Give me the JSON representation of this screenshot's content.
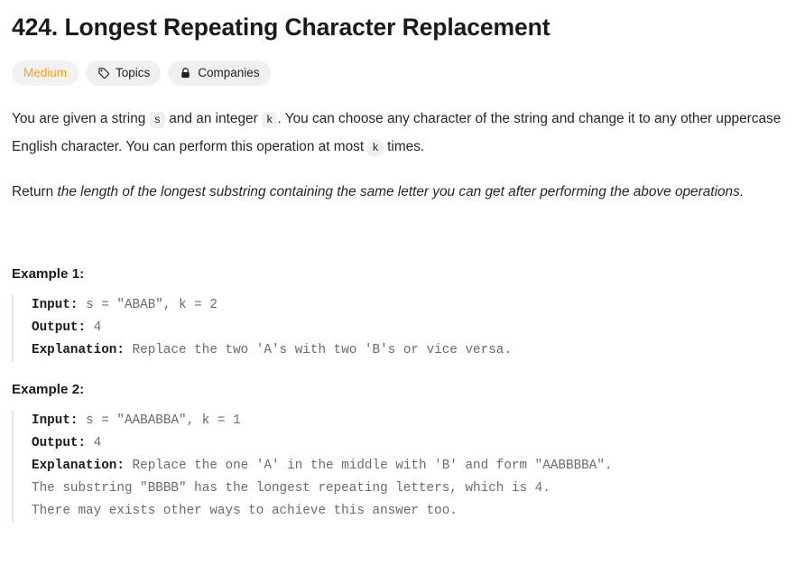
{
  "problem": {
    "title": "424. Longest Repeating Character Replacement",
    "badges": [
      {
        "id": "difficulty",
        "label": "Medium",
        "icon": null,
        "color": "#ffa116"
      },
      {
        "id": "topics",
        "label": "Topics",
        "icon": "tag-icon",
        "color": "#1f1f1f"
      },
      {
        "id": "companies",
        "label": "Companies",
        "icon": "lock-icon",
        "color": "#1f1f1f"
      }
    ],
    "description": {
      "paragraph1": {
        "part1": "You are given a string ",
        "code1": "s",
        "part2": " and an integer ",
        "code2": "k",
        "part3": ". You can choose any character of the string and change it to any other uppercase English character. You can perform this operation at most ",
        "code3": "k",
        "part4": " times."
      },
      "paragraph2": {
        "lead": "Return ",
        "italic": "the length of the longest substring containing the same letter you can get after performing the above operations."
      }
    },
    "examples": [
      {
        "heading": "Example 1:",
        "input_label": "Input:",
        "input_value": " s = \"ABAB\", k = 2",
        "output_label": "Output:",
        "output_value": " 4",
        "explanation_label": "Explanation:",
        "explanation_value": " Replace the two 'A's with two 'B's or vice versa."
      },
      {
        "heading": "Example 2:",
        "input_label": "Input:",
        "input_value": " s = \"AABABBA\", k = 1",
        "output_label": "Output:",
        "output_value": " 4",
        "explanation_label": "Explanation:",
        "explanation_value": " Replace the one 'A' in the middle with 'B' and form \"AABBBBA\".\nThe substring \"BBBB\" has the longest repeating letters, which is 4.\nThere may exists other ways to achieve this answer too."
      }
    ]
  }
}
